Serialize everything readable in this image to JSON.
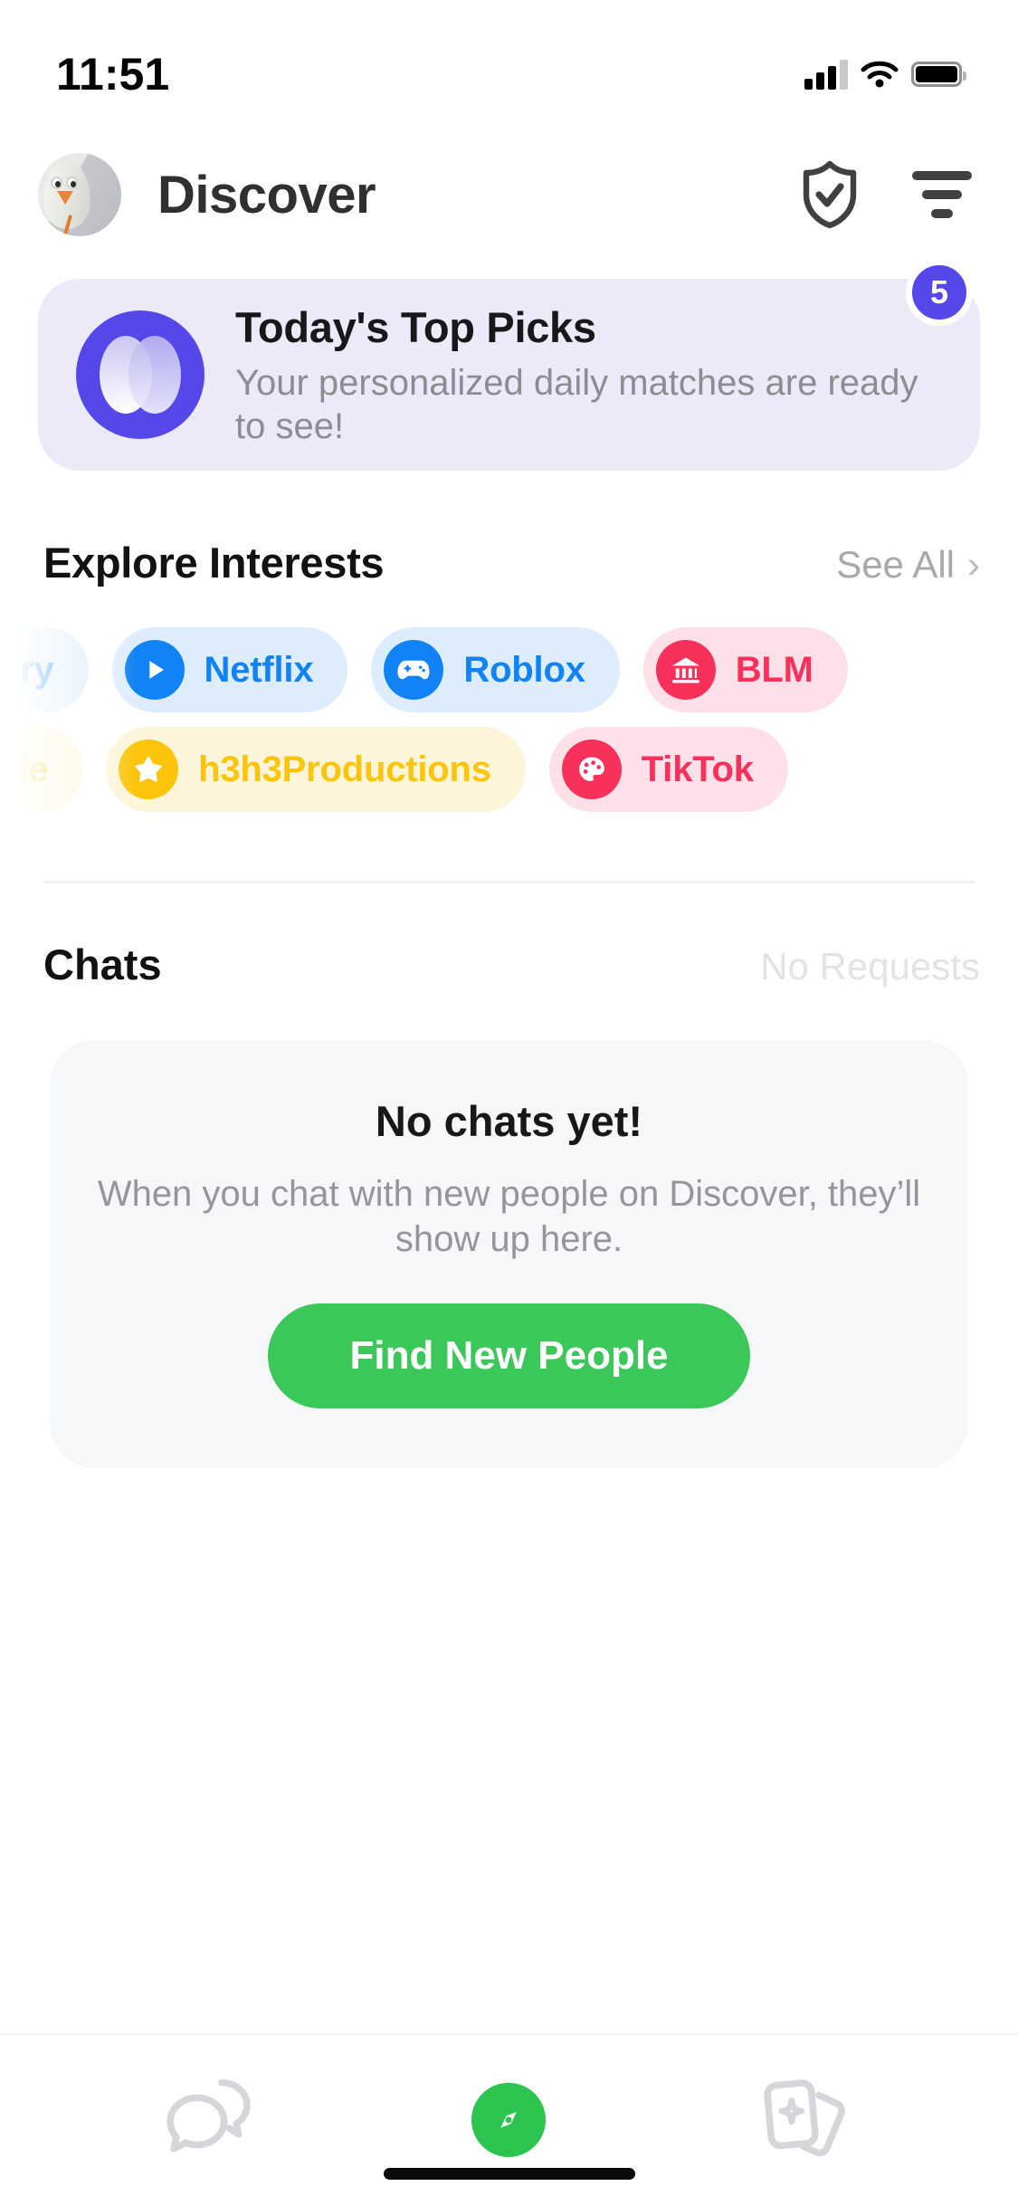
{
  "status_bar": {
    "time": "11:51",
    "cellular_icon": "cellular-signal-icon",
    "wifi_icon": "wifi-icon",
    "battery_icon": "battery-icon"
  },
  "header": {
    "avatar_name": "user-avatar-bird",
    "title": "Discover",
    "shield_icon": "shield-check-icon",
    "filter_icon": "filter-icon"
  },
  "banner": {
    "title": "Today's Top Picks",
    "subtitle": "Your personalized daily matches are ready to see!",
    "badge_count": "5",
    "icon_name": "overlapping-circles-icon",
    "accent_color": "#5449e8",
    "background_color": "#eceaf9"
  },
  "interests": {
    "section_title": "Explore Interests",
    "see_all_label": "See All",
    "chevron": "›",
    "rows": [
      [
        {
          "label": "r Story",
          "icon": "none",
          "theme": "blue",
          "clipped": true
        },
        {
          "label": "Netflix",
          "icon": "play-icon",
          "theme": "blue",
          "clipped": false
        },
        {
          "label": "Roblox",
          "icon": "gamepad-icon",
          "theme": "blue",
          "clipped": false
        },
        {
          "label": "BLM",
          "icon": "bank-icon",
          "theme": "pink",
          "clipped": true
        }
      ],
      [
        {
          "label": "DiePie",
          "icon": "none",
          "theme": "yellow",
          "clipped": true
        },
        {
          "label": "h3h3Productions",
          "icon": "star-icon",
          "theme": "yellow",
          "clipped": false
        },
        {
          "label": "TikTok",
          "icon": "palette-icon",
          "theme": "pink",
          "clipped": false
        }
      ]
    ]
  },
  "chats": {
    "section_title": "Chats",
    "requests_label": "No Requests",
    "empty_title": "No chats yet!",
    "empty_subtitle": "When you chat with new people on Discover, they’ll show up here.",
    "cta_label": "Find New People",
    "cta_color": "#3cc75a"
  },
  "tabbar": {
    "items": [
      {
        "name": "chats-tab",
        "icon": "chat-bubbles-icon",
        "active": false
      },
      {
        "name": "discover-tab",
        "icon": "compass-icon",
        "active": true
      },
      {
        "name": "cards-tab",
        "icon": "cards-sparkle-icon",
        "active": false
      }
    ],
    "active_color": "#2cc44e",
    "inactive_color": "#d5d6d9"
  }
}
